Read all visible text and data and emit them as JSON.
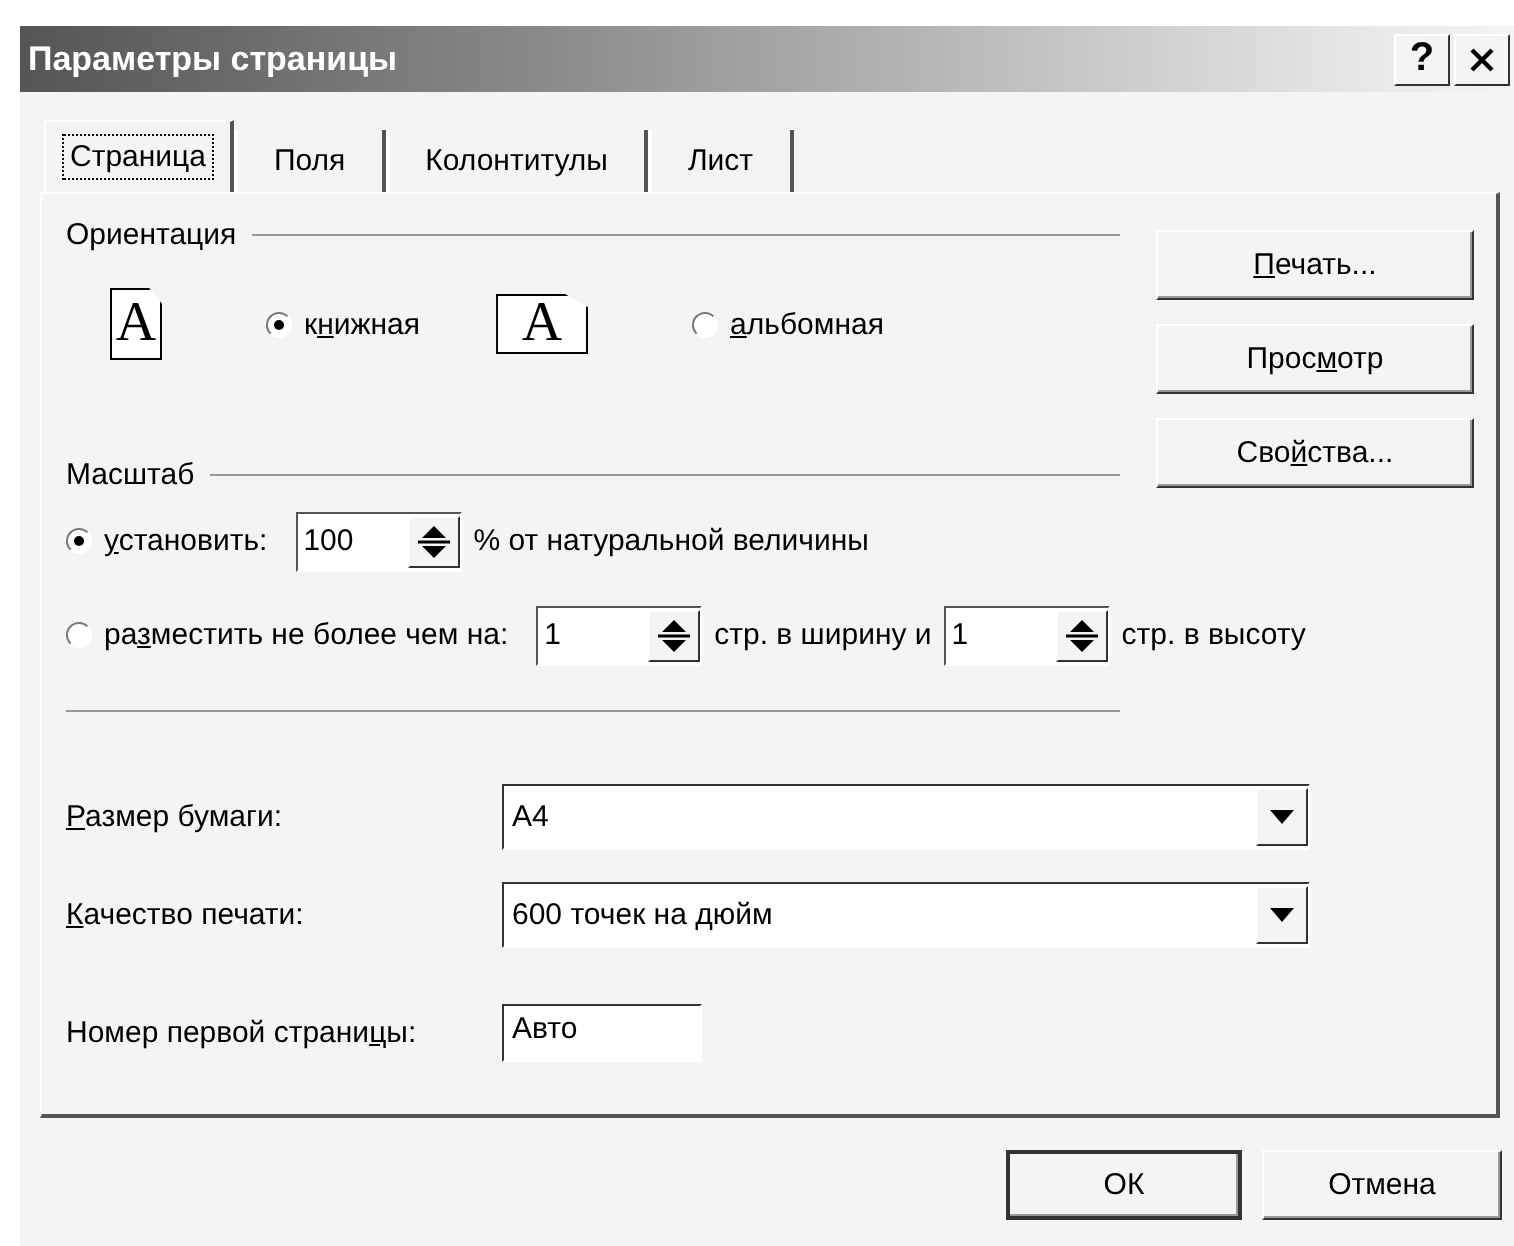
{
  "window": {
    "title": "Параметры страницы",
    "help": "?"
  },
  "tabs": [
    {
      "label": "Страница",
      "selected": true
    },
    {
      "label": "Поля",
      "selected": false
    },
    {
      "label": "Колонтитулы",
      "selected": false
    },
    {
      "label": "Лист",
      "selected": false
    }
  ],
  "orientation": {
    "legend": "Ориентация",
    "options": [
      {
        "kind": "portrait",
        "icon_letter": "A",
        "selected": true,
        "label": {
          "before": "к",
          "key": "н",
          "after": "ижная"
        }
      },
      {
        "kind": "landscape",
        "icon_letter": "A",
        "selected": false,
        "label": {
          "key": "а",
          "after": "льбомная"
        }
      }
    ]
  },
  "side_buttons": [
    {
      "key": "П",
      "after": "ечать..."
    },
    {
      "before": "Прос",
      "key": "м",
      "after": "отр"
    },
    {
      "before": "Сво",
      "key": "й",
      "after": "ства..."
    }
  ],
  "scale": {
    "legend": "Масштаб",
    "options": [
      {
        "selected": true,
        "label": {
          "key": "у",
          "after": "становить:"
        },
        "parts": [
          {
            "kind": "spin",
            "value": "100"
          },
          {
            "kind": "text",
            "text": "% от натуральной величины"
          }
        ]
      },
      {
        "selected": false,
        "label": {
          "before": "ра",
          "key": "з",
          "after": "местить не более чем на:"
        },
        "parts": [
          {
            "kind": "spin",
            "value": "1"
          },
          {
            "kind": "text",
            "text": "стр. в ширину и"
          },
          {
            "kind": "spin",
            "value": "1"
          },
          {
            "kind": "text",
            "text": "стр. в высоту"
          }
        ]
      }
    ]
  },
  "fields": [
    {
      "kind": "combo",
      "label": {
        "key": "Р",
        "after": "азмер бумаги:"
      },
      "value": "A4"
    },
    {
      "kind": "combo",
      "label": {
        "key": "К",
        "after": "ачество печати:"
      },
      "value": "600 точек на дюйм"
    },
    {
      "kind": "text",
      "label": {
        "before": "Номер первой страни",
        "key": "ц",
        "after": "ы:"
      },
      "value": "Авто"
    }
  ],
  "footer_buttons": [
    {
      "label": "ОК",
      "default": true
    },
    {
      "label": "Отмена",
      "default": false
    }
  ]
}
